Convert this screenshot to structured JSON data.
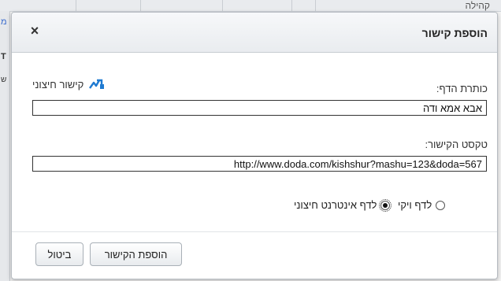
{
  "background": {
    "side_text": "קהילה",
    "left_link": "מ",
    "left_bold": "T",
    "left_small": "ש"
  },
  "dialog": {
    "title": "הוספת קישור",
    "close_glyph": "×",
    "external_link_label": "קישור חיצוני",
    "page_title_label": "כותרת הדף:",
    "page_title_value": "אבא אמא ודה",
    "link_text_label": "טקסט הקישור:",
    "link_text_value": "http://www.doda.com/kishshur?mashu=123&doda=567",
    "radio_options": [
      {
        "label": "לדף ויקי",
        "checked": false
      },
      {
        "label": "לדף אינטרנט חיצוני",
        "checked": true
      }
    ],
    "add_button": "הוספת הקישור",
    "cancel_button": "ביטול"
  },
  "colors": {
    "accent": "#1f7ad1",
    "header_bg": "#e9ecef"
  },
  "icons": {
    "external_link": "external-link-icon",
    "close": "close-icon"
  }
}
